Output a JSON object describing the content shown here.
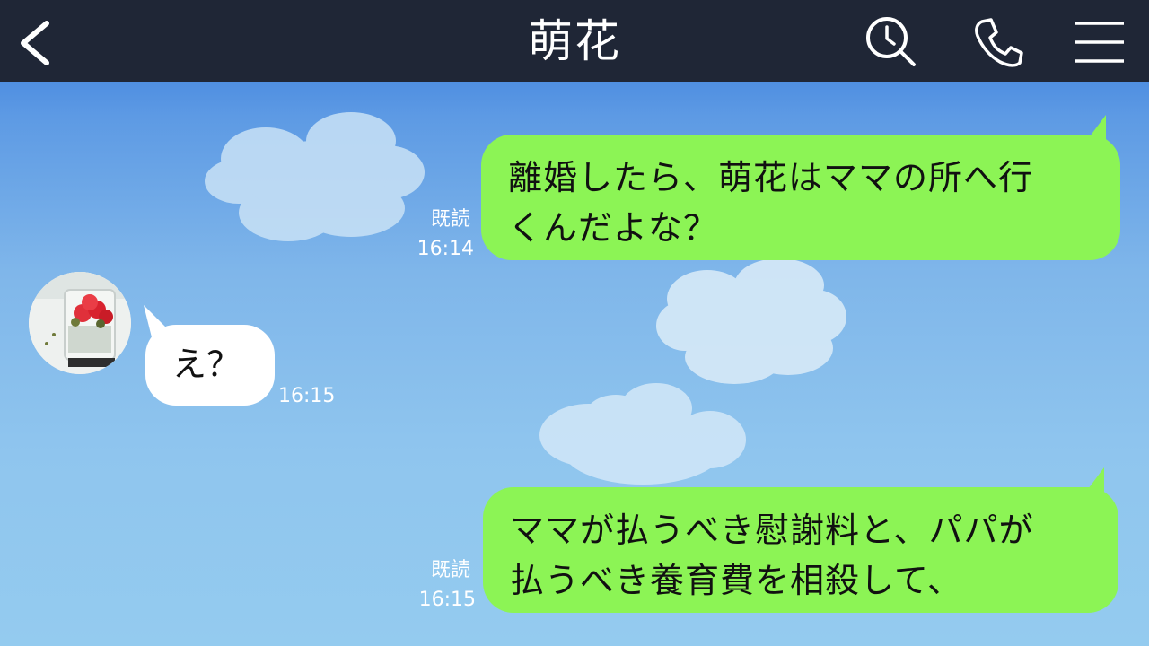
{
  "header": {
    "title": "萌花",
    "icons": [
      "chevron-left-icon",
      "search-clock-icon",
      "phone-icon",
      "menu-icon"
    ],
    "background_color": "#1f2636"
  },
  "messages": [
    {
      "direction": "outgoing",
      "lines": [
        "離婚したら、萌花はママの所へ行",
        "くんだよな？"
      ],
      "read": "既読",
      "time": "16:14"
    },
    {
      "direction": "incoming",
      "lines": [
        "え？"
      ],
      "time": "16:15"
    },
    {
      "direction": "outgoing",
      "lines": [
        "ママが払うべき慰謝料と、パパが",
        "払うべき養育費を相殺して、"
      ],
      "read": "既読",
      "time": "16:15"
    }
  ],
  "colors": {
    "outgoing_bubble": "#8cf455",
    "incoming_bubble": "#ffffff",
    "sky_top": "#2f74d9",
    "sky_bottom": "#94cbef"
  }
}
